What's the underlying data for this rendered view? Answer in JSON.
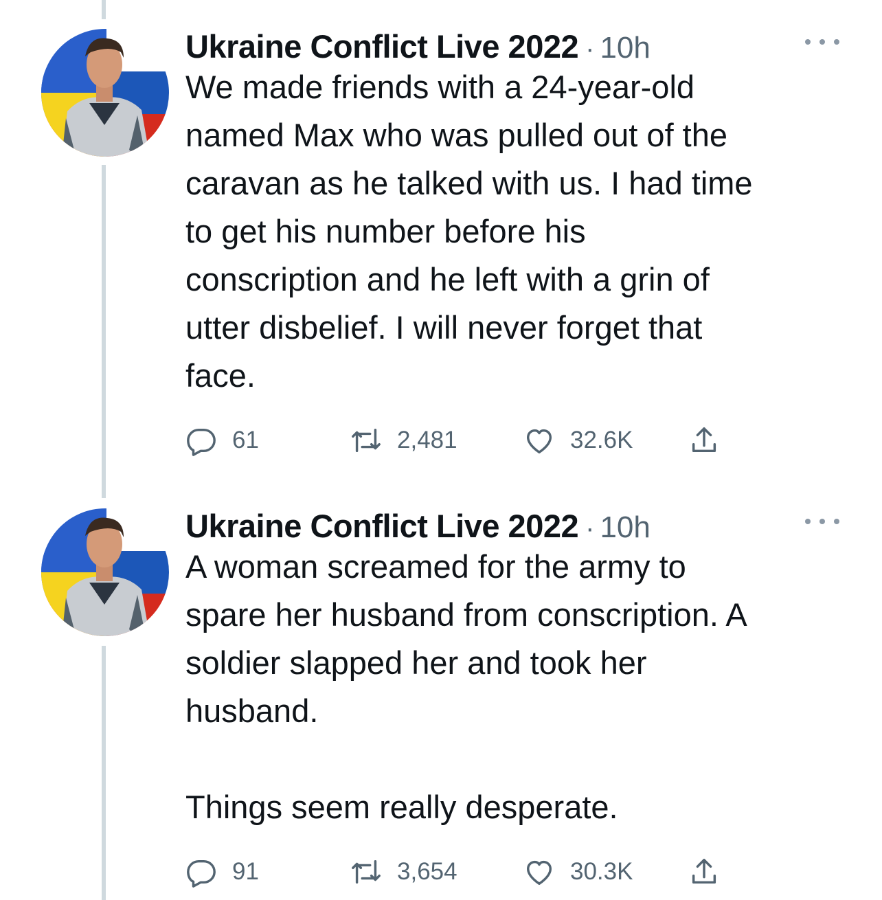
{
  "colors": {
    "text": "#0f1419",
    "secondary": "#536471",
    "thread_line": "#cfd9de"
  },
  "tweets": [
    {
      "author": "Ukraine Conflict Live 2022",
      "separator": "·",
      "time": "10h",
      "text": "We made friends with a 24-year-old\nnamed Max who was pulled out of the\ncaravan as he talked with us. I had time\nto get his number before his\nconscription and he left with a grin of\nutter disbelief. I will never forget that\nface.",
      "replies": "61",
      "retweets": "2,481",
      "likes": "32.6K",
      "icons": {
        "reply": "reply-icon",
        "retweet": "retweet-icon",
        "like": "heart-icon",
        "share": "share-icon",
        "more": "more-icon"
      }
    },
    {
      "author": "Ukraine Conflict Live 2022",
      "separator": "·",
      "time": "10h",
      "text": "A woman screamed for the army to\nspare her husband from conscription. A\nsoldier slapped her and took her\nhusband.\n\nThings seem really desperate.",
      "replies": "91",
      "retweets": "3,654",
      "likes": "30.3K",
      "icons": {
        "reply": "reply-icon",
        "retweet": "retweet-icon",
        "like": "heart-icon",
        "share": "share-icon",
        "more": "more-icon"
      }
    }
  ]
}
